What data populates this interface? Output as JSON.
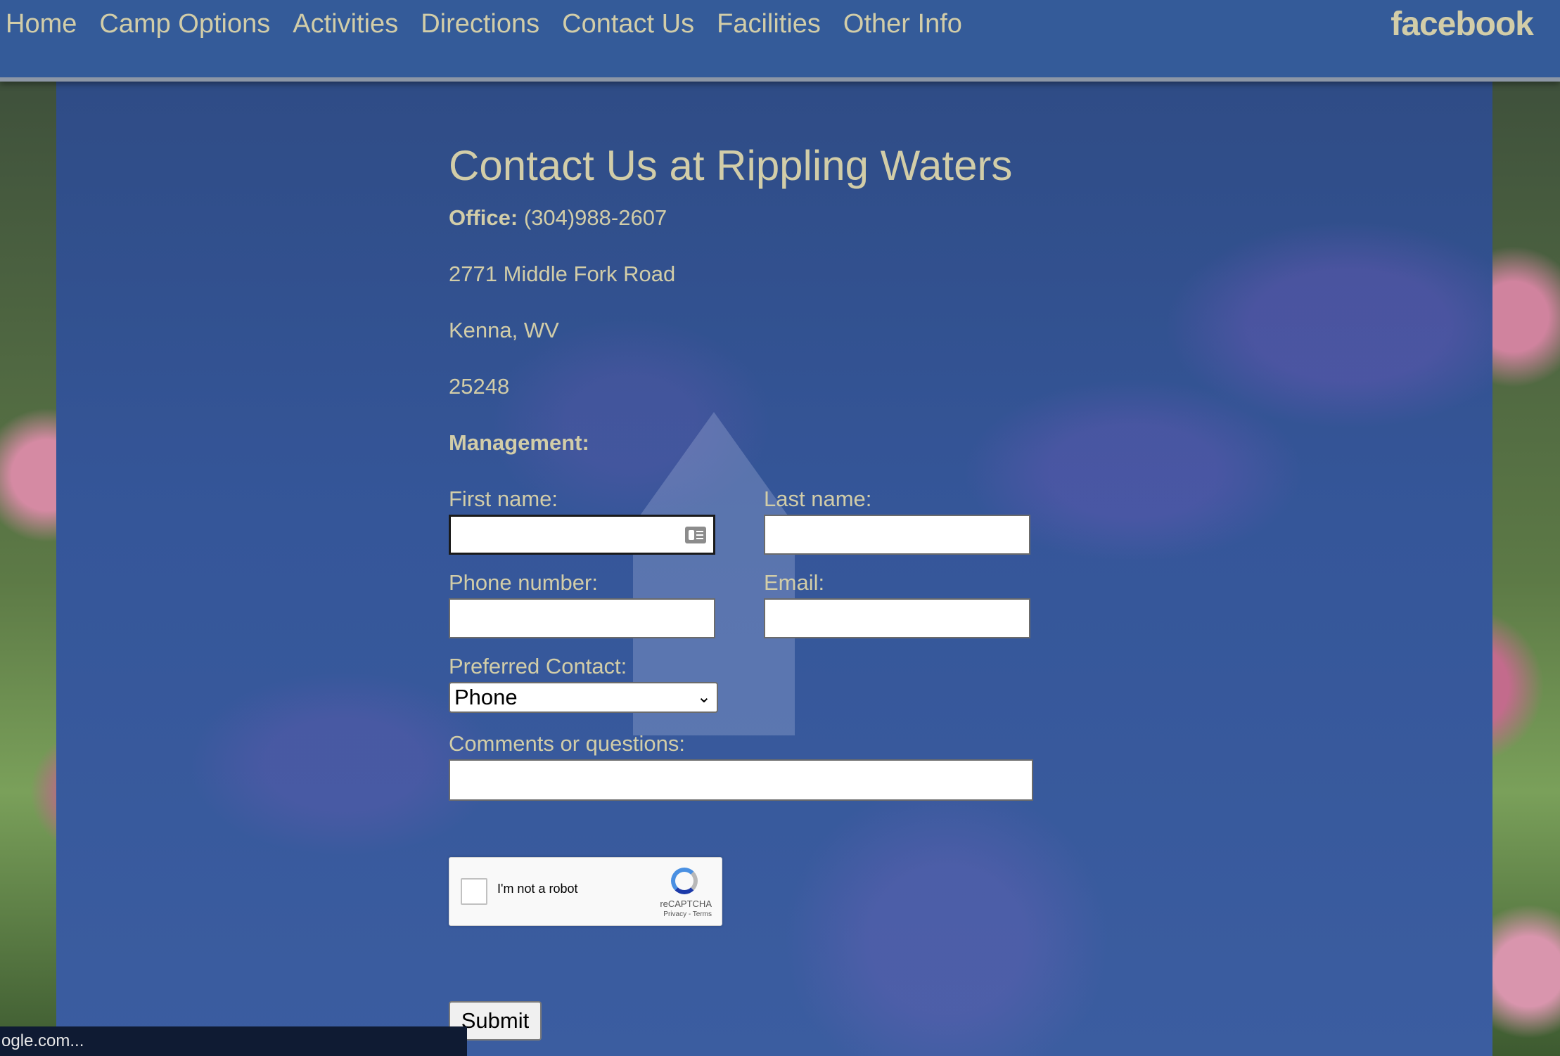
{
  "nav": {
    "items": [
      "Home",
      "Camp Options",
      "Activities",
      "Directions",
      "Contact Us",
      "Facilities",
      "Other Info"
    ],
    "social": "facebook"
  },
  "contact": {
    "title": "Contact Us at Rippling Waters",
    "office_label": "Office:",
    "office_phone": "(304)988-2607",
    "address_line1": "2771 Middle Fork Road",
    "address_line2": "Kenna, WV",
    "zip": "25248",
    "management_label": "Management:"
  },
  "form": {
    "first_name_label": "First name:",
    "last_name_label": "Last name:",
    "phone_label": "Phone number:",
    "email_label": "Email:",
    "preferred_label": "Preferred Contact:",
    "preferred_value": "Phone",
    "comments_label": "Comments or questions:",
    "submit_label": "Submit"
  },
  "recaptcha": {
    "label": "I'm not a robot",
    "brand": "reCAPTCHA",
    "links": "Privacy - Terms"
  },
  "status_bar": {
    "text": "ogle.com..."
  }
}
